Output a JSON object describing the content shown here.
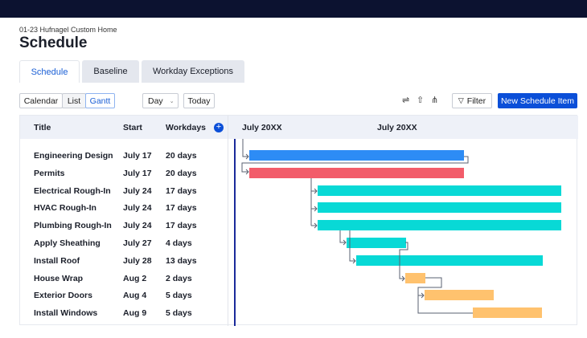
{
  "project": "01-23 Hufnagel Custom Home",
  "title": "Schedule",
  "tabs": [
    "Schedule",
    "Baseline",
    "Workday Exceptions"
  ],
  "view_buttons": [
    "Calendar",
    "List",
    "Gantt"
  ],
  "zoom_select": "Day",
  "today_label": "Today",
  "toolbar_icons": [
    "sliders-icon",
    "share-icon",
    "collapse-icon"
  ],
  "filter_label": "Filter",
  "new_item_label": "New Schedule Item",
  "columns": {
    "title": "Title",
    "start": "Start",
    "workdays": "Workdays"
  },
  "timeline_months": [
    "July 20XX",
    "July 20XX"
  ],
  "colors": {
    "blue": "#2d8cf5",
    "red": "#f25c6a",
    "cyan": "#08d9d6",
    "orange": "#ffc26e",
    "accent": "#0b4fd8"
  },
  "rows": [
    {
      "title": "Engineering Design",
      "start": "July 17",
      "workdays": "20 days",
      "color": "blue"
    },
    {
      "title": "Permits",
      "start": "July 17",
      "workdays": "20 days",
      "color": "red"
    },
    {
      "title": "Electrical Rough-In",
      "start": "July 24",
      "workdays": "17 days",
      "color": "cyan"
    },
    {
      "title": "HVAC Rough-In",
      "start": "July 24",
      "workdays": "17 days",
      "color": "cyan"
    },
    {
      "title": "Plumbing Rough-In",
      "start": "July 24",
      "workdays": "17 days",
      "color": "cyan"
    },
    {
      "title": "Apply Sheathing",
      "start": "July 27",
      "workdays": "4 days",
      "color": "cyan"
    },
    {
      "title": "Install Roof",
      "start": "July 28",
      "workdays": "13 days",
      "color": "cyan"
    },
    {
      "title": "House Wrap",
      "start": "Aug 2",
      "workdays": "2 days",
      "color": "orange"
    },
    {
      "title": "Exterior Doors",
      "start": "Aug 4",
      "workdays": "5 days",
      "color": "orange"
    },
    {
      "title": "Install Windows",
      "start": "Aug 9",
      "workdays": "5 days",
      "color": "orange"
    }
  ]
}
